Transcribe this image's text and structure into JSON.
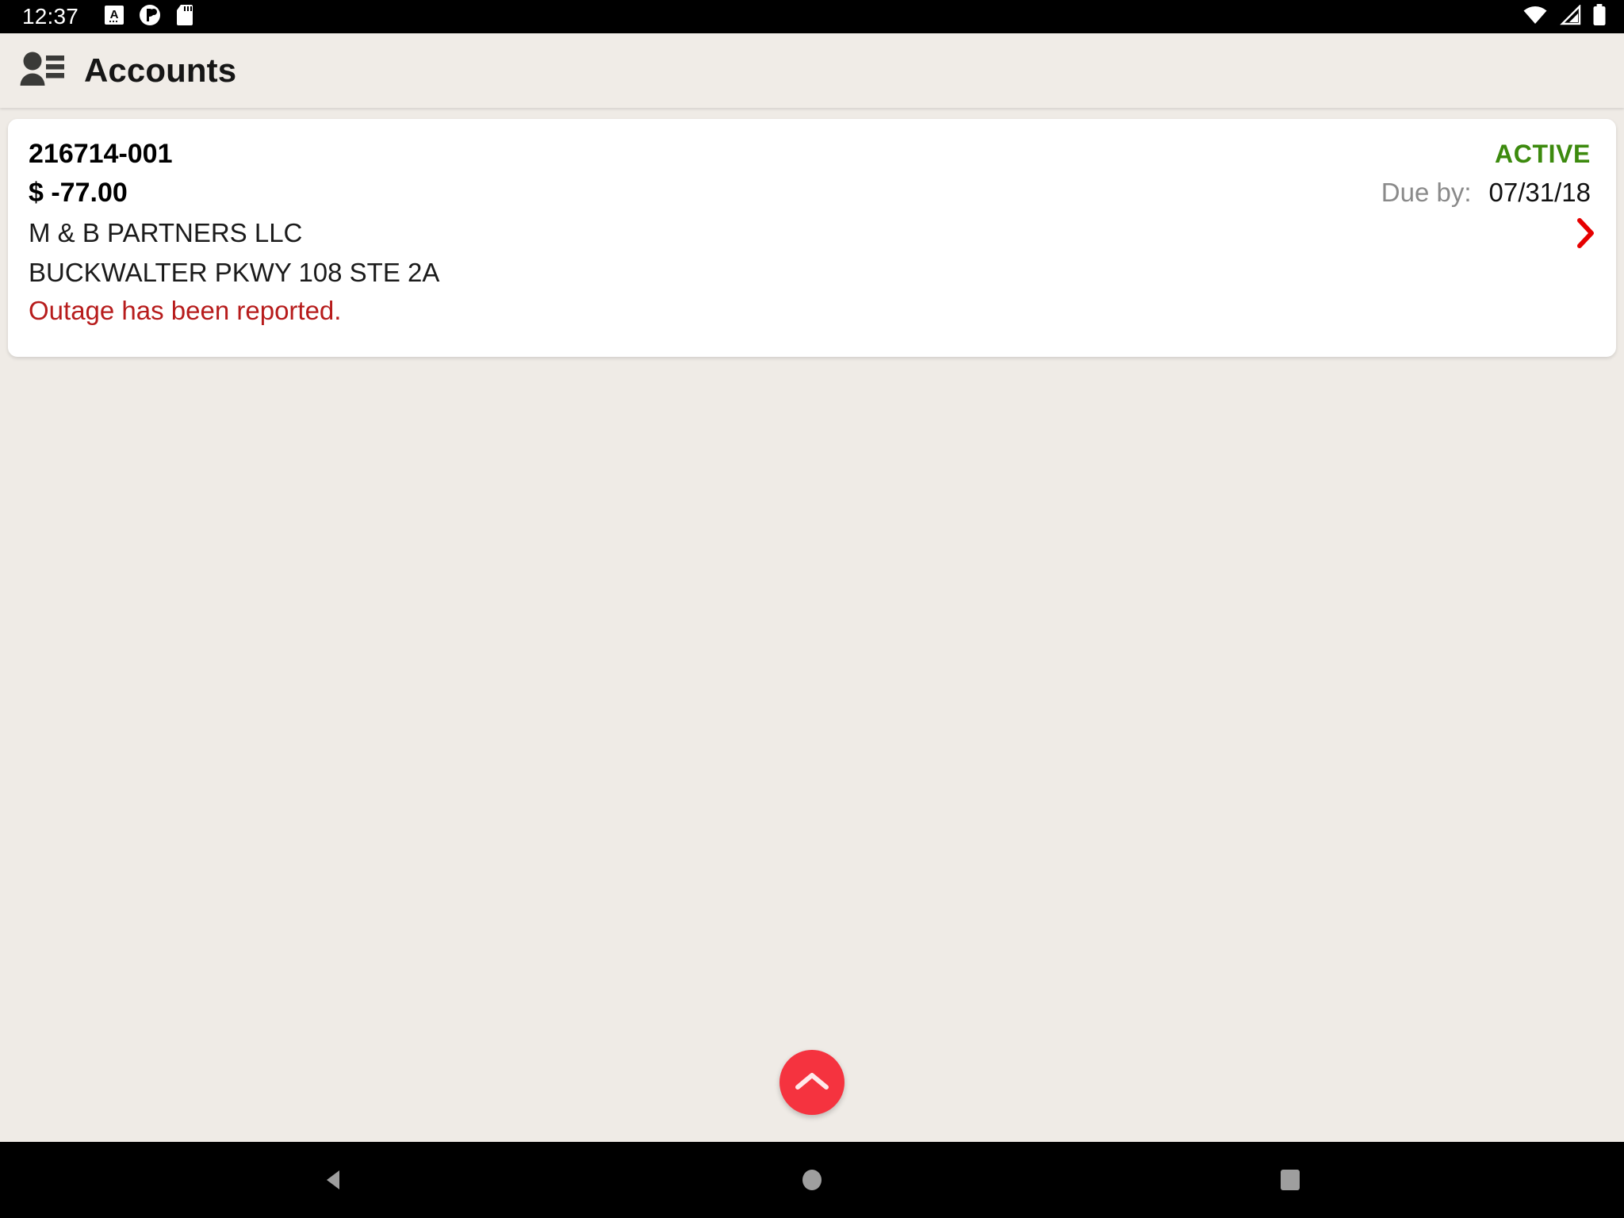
{
  "status_bar": {
    "time": "12:37",
    "left_icons": [
      {
        "name": "keyboard-language-icon",
        "glyph": "A"
      },
      {
        "name": "app-notification-icon",
        "glyph": ""
      },
      {
        "name": "sd-card-icon",
        "glyph": ""
      }
    ],
    "right_icons": [
      {
        "name": "wifi-icon"
      },
      {
        "name": "cellular-signal-icon"
      },
      {
        "name": "battery-icon"
      }
    ]
  },
  "app_bar": {
    "title": "Accounts",
    "icon_name": "account-box-icon"
  },
  "accounts": [
    {
      "account_number": "216714-001",
      "status": "ACTIVE",
      "amount": "$ -77.00",
      "due_label": "Due by:",
      "due_date": "07/31/18",
      "customer_name": "M & B PARTNERS LLC",
      "address": "BUCKWALTER PKWY 108 STE 2A",
      "note": "Outage has been reported.",
      "chevron_icon": "chevron-right-icon"
    }
  ],
  "fab": {
    "icon_name": "chevron-up-icon",
    "color": "#f5333f"
  },
  "nav_bar": {
    "back": "back-button",
    "home": "home-button",
    "recents": "recents-button"
  },
  "colors": {
    "background": "#efebe6",
    "card": "#ffffff",
    "status_active": "#3c8a0e",
    "alert_red": "#b71c1c",
    "accent_red": "#e60000",
    "fab_red": "#f5333f",
    "muted_text": "#8a8a8a"
  }
}
